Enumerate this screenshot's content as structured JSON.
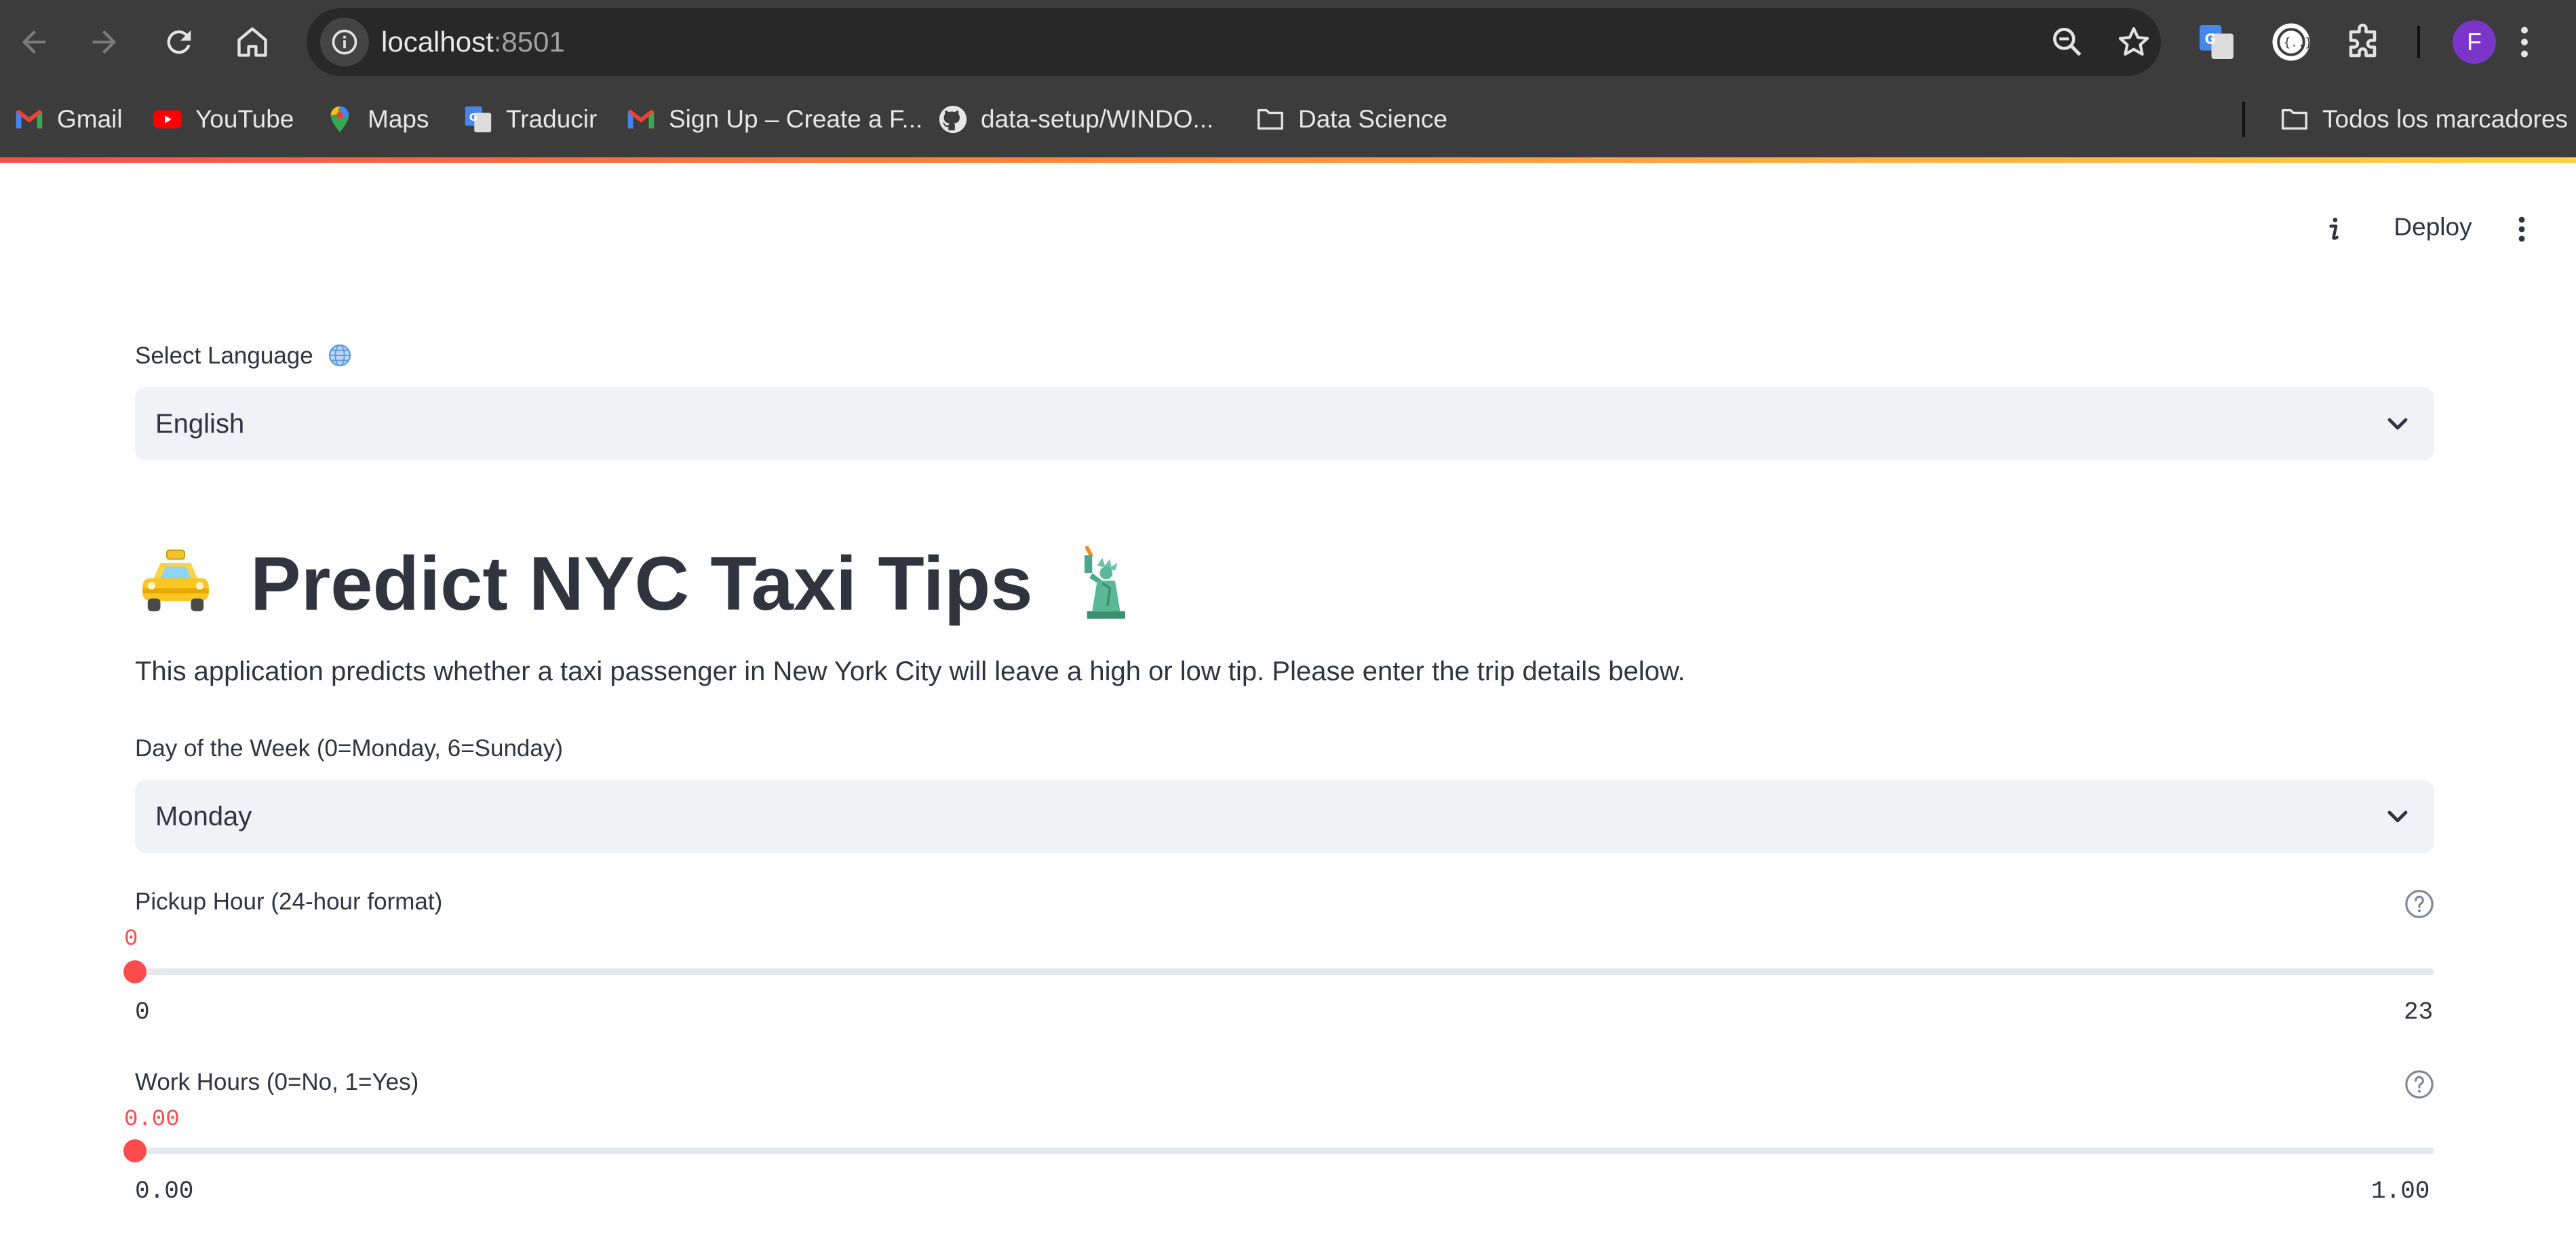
{
  "browser": {
    "url_host": "localhost",
    "url_port": ":8501",
    "profile_initial": "F",
    "bookmarks": [
      {
        "label": "Gmail",
        "icon": "gmail-icon"
      },
      {
        "label": "YouTube",
        "icon": "youtube-icon"
      },
      {
        "label": "Maps",
        "icon": "maps-icon"
      },
      {
        "label": "Traducir",
        "icon": "translate-icon"
      },
      {
        "label": "Sign Up – Create a F...",
        "icon": "gmail-icon"
      },
      {
        "label": "data-setup/WINDO...",
        "icon": "github-icon"
      },
      {
        "label": "Data Science",
        "icon": "folder-icon"
      }
    ],
    "all_bookmarks_label": "Todos los marcadores",
    "accent_color": "#ff4b4b"
  },
  "app": {
    "deploy_label": "Deploy",
    "language": {
      "label": "Select Language",
      "label_icon": "globe-icon",
      "value": "English"
    },
    "title": "Predict NYC Taxi Tips",
    "title_icons": [
      "taxi-icon",
      "statue-of-liberty-icon"
    ],
    "description": "This application predicts whether a taxi passenger in New York City will leave a high or low tip. Please enter the trip details below.",
    "day_of_week": {
      "label": "Day of the Week (0=Monday, 6=Sunday)",
      "value": "Monday"
    },
    "pickup_hour": {
      "label": "Pickup Hour (24-hour format)",
      "value": "0",
      "min": "0",
      "max": "23",
      "fraction": 0
    },
    "work_hours": {
      "label": "Work Hours (0=No, 1=Yes)",
      "value": "0.00",
      "min": "0.00",
      "max": "1.00",
      "fraction": 0
    }
  }
}
